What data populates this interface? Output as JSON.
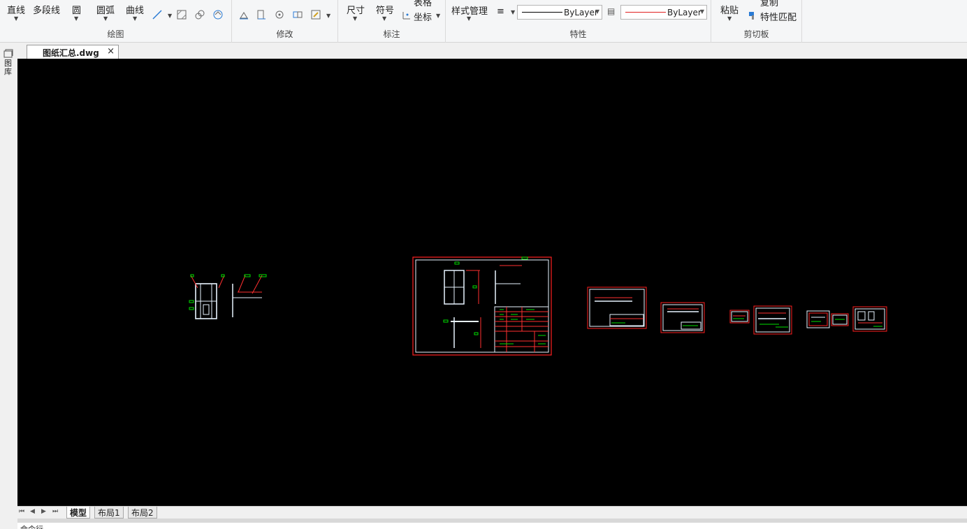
{
  "ribbon": {
    "draw": {
      "group_label": "绘图",
      "line": "直线",
      "polyline": "多段线",
      "circle": "圆",
      "arc": "圆弧",
      "curve": "曲线"
    },
    "modify": {
      "group_label": "修改"
    },
    "annotation": {
      "group_label": "标注",
      "dimension": "尺寸",
      "symbol": "符号",
      "table": "表格",
      "coordinate": "坐标"
    },
    "properties": {
      "group_label": "特性",
      "style_manager": "样式管理",
      "linetype": "ByLayer",
      "color": "ByLayer"
    },
    "clipboard": {
      "group_label": "剪切板",
      "paste": "粘贴",
      "copy": "复制",
      "match_props": "特性匹配"
    }
  },
  "document": {
    "tab_name": "图纸汇总.dwg",
    "close": "×"
  },
  "side_panel": {
    "label": "图库"
  },
  "layout_tabs": [
    {
      "label": "模型",
      "active": true
    },
    {
      "label": "布局1",
      "active": false
    },
    {
      "label": "布局2",
      "active": false
    }
  ],
  "command": {
    "label": "命令行"
  },
  "colors": {
    "canvas": "#000000",
    "frame": "#ff2020",
    "linework": "#e8f4ff",
    "accent": "#00e000",
    "dim": "#ff3030"
  }
}
